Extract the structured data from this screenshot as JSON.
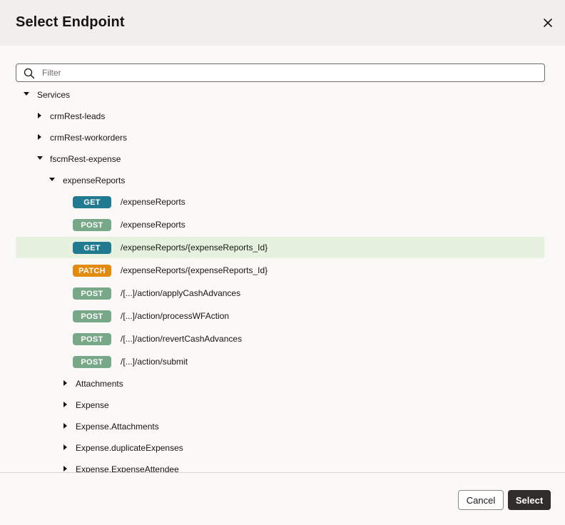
{
  "dialog": {
    "title": "Select Endpoint",
    "close_icon": "close-icon"
  },
  "filter": {
    "placeholder": "Filter",
    "value": "",
    "icon": "search-icon"
  },
  "tree": {
    "root": {
      "label": "Services",
      "expanded": true
    },
    "services": [
      {
        "label": "crmRest-leads",
        "expanded": false
      },
      {
        "label": "crmRest-workorders",
        "expanded": false
      },
      {
        "label": "fscmRest-expense",
        "expanded": true
      }
    ],
    "resource": {
      "label": "expenseReports",
      "expanded": true
    },
    "endpoints": [
      {
        "method": "GET",
        "path": "/expenseReports",
        "selected": false
      },
      {
        "method": "POST",
        "path": "/expenseReports",
        "selected": false
      },
      {
        "method": "GET",
        "path": "/expenseReports/{expenseReports_Id}",
        "selected": true
      },
      {
        "method": "PATCH",
        "path": "/expenseReports/{expenseReports_Id}",
        "selected": false
      },
      {
        "method": "POST",
        "path": "/[...]/action/applyCashAdvances",
        "selected": false
      },
      {
        "method": "POST",
        "path": "/[...]/action/processWFAction",
        "selected": false
      },
      {
        "method": "POST",
        "path": "/[...]/action/revertCashAdvances",
        "selected": false
      },
      {
        "method": "POST",
        "path": "/[...]/action/submit",
        "selected": false
      }
    ],
    "children": [
      {
        "label": "Attachments",
        "expanded": false
      },
      {
        "label": "Expense",
        "expanded": false
      },
      {
        "label": "Expense.Attachments",
        "expanded": false
      },
      {
        "label": "Expense.duplicateExpenses",
        "expanded": false
      },
      {
        "label": "Expense.ExpenseAttendee",
        "expanded": false
      }
    ]
  },
  "colors": {
    "get": "#227a91",
    "post": "#78a887",
    "patch": "#e38a10",
    "selected_row": "#e6f2df",
    "primary_button": "#312d2a"
  },
  "footer": {
    "cancel_label": "Cancel",
    "select_label": "Select"
  }
}
